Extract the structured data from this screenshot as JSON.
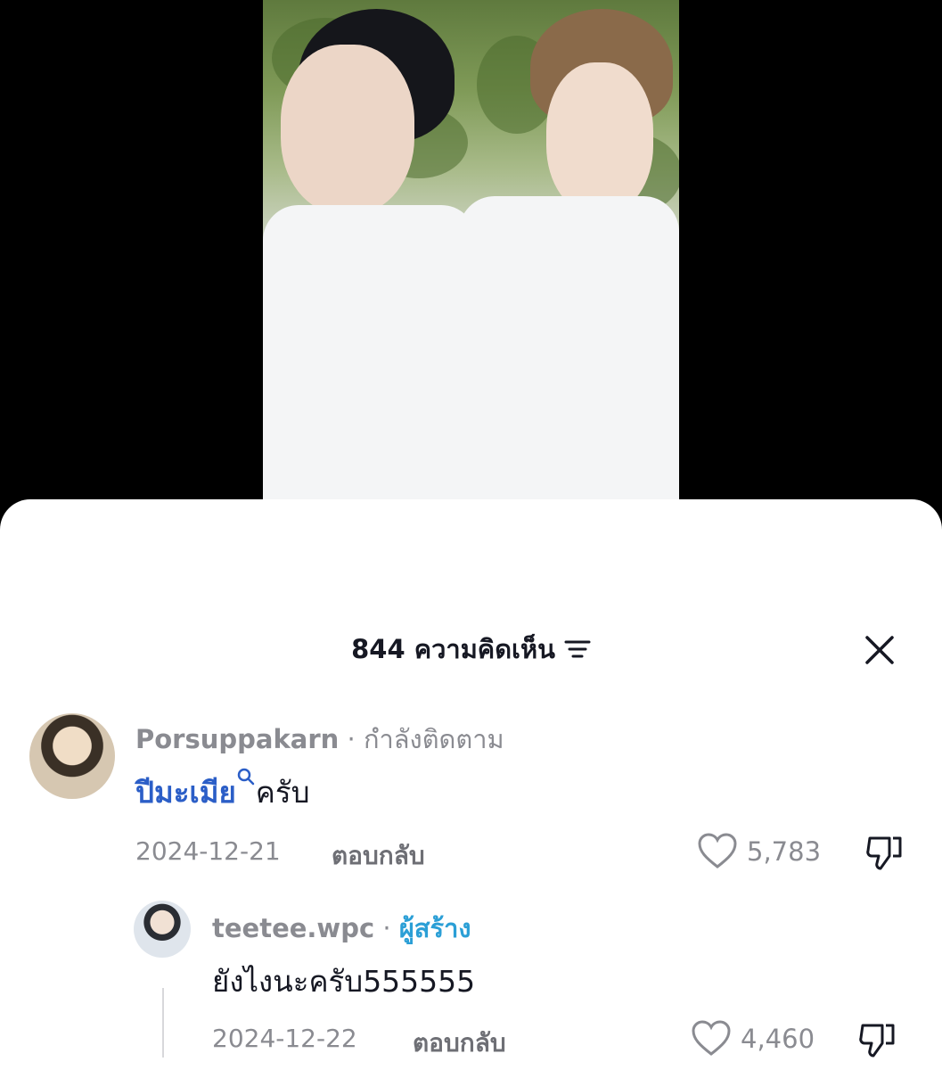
{
  "video": {
    "description_icon": "video-frame"
  },
  "comments_panel": {
    "count_label": "844 ความคิดเห็น",
    "filter_icon": "filter-icon",
    "close_icon": "close-icon"
  },
  "comments": [
    {
      "author": "Porsuppakarn",
      "separator": " · ",
      "status": "กำลังติดตาม",
      "text_keyword": "ปีมะเมีย",
      "text_rest": "ครับ",
      "date": "2024-12-21",
      "reply_label": "ตอบกลับ",
      "likes": "5,783"
    },
    {
      "author": "teetee.wpc",
      "separator": " · ",
      "status": "ผู้สร้าง",
      "text": "ยังไงนะครับ555555",
      "date": "2024-12-22",
      "reply_label": "ตอบกลับ",
      "likes": "4,460"
    }
  ]
}
